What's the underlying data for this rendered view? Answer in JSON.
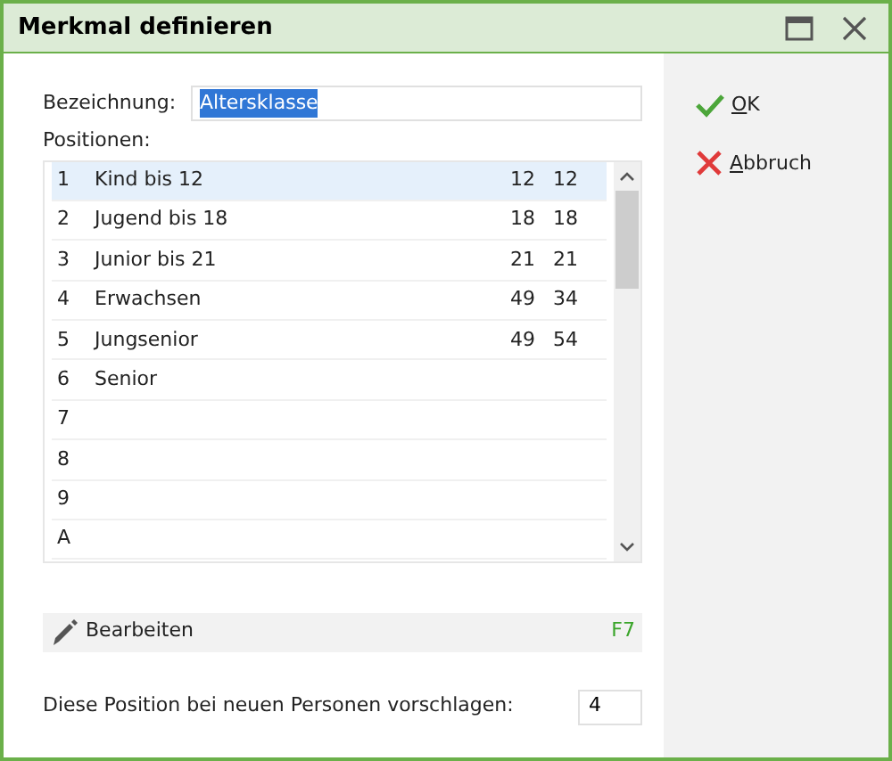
{
  "window": {
    "title": "Merkmal definieren"
  },
  "name_field": {
    "label": "Bezeichnung:",
    "value": "Altersklasse",
    "text_selected": true
  },
  "positions": {
    "label": "Positionen:",
    "rows": [
      {
        "number": "1",
        "label": "Kind bis 12",
        "value_1": "12",
        "value_2": "12",
        "selected": true
      },
      {
        "number": "2",
        "label": "Jugend bis 18",
        "value_1": "18",
        "value_2": "18",
        "selected": false
      },
      {
        "number": "3",
        "label": "Junior bis 21",
        "value_1": "21",
        "value_2": "21",
        "selected": false
      },
      {
        "number": "4",
        "label": "Erwachsen",
        "value_1": "49",
        "value_2": "34",
        "selected": false
      },
      {
        "number": "5",
        "label": "Jungsenior",
        "value_1": "49",
        "value_2": "54",
        "selected": false
      },
      {
        "number": "6",
        "label": "Senior",
        "selected": false
      },
      {
        "number": "7",
        "selected": false
      },
      {
        "number": "8",
        "selected": false
      },
      {
        "number": "9",
        "selected": false
      },
      {
        "number": "A",
        "selected": false
      }
    ]
  },
  "edit_bar": {
    "label": "Bearbeiten",
    "shortcut": "F7"
  },
  "default_position": {
    "label": "Diese Position bei neuen Personen vorschlagen:",
    "value": "4"
  },
  "buttons": [
    {
      "kind": "ok",
      "mnemonic": "O",
      "rest": "K"
    },
    {
      "kind": "cancel",
      "mnemonic": "A",
      "rest": "bbruch"
    }
  ]
}
